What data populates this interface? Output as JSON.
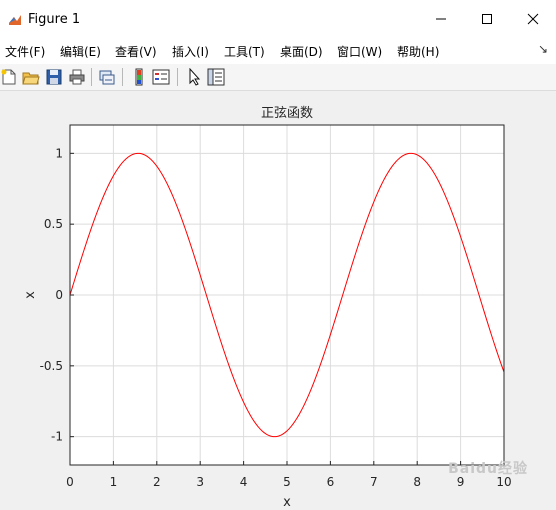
{
  "window": {
    "title": "Figure 1",
    "controls": [
      "minimize",
      "maximize",
      "close"
    ]
  },
  "menu": {
    "items": [
      {
        "label": "文件(F)"
      },
      {
        "label": "编辑(E)"
      },
      {
        "label": "查看(V)"
      },
      {
        "label": "插入(I)"
      },
      {
        "label": "工具(T)"
      },
      {
        "label": "桌面(D)"
      },
      {
        "label": "窗口(W)"
      },
      {
        "label": "帮助(H)"
      }
    ],
    "overflow_icon": "arrow-icon"
  },
  "toolbar": {
    "icons": [
      "new-figure-icon",
      "open-file-icon",
      "save-icon",
      "print-icon",
      "link-plot-icon",
      "colorbar-icon",
      "legend-icon",
      "edit-plot-icon",
      "property-inspector-icon"
    ]
  },
  "watermark": "Baidu经验",
  "chart_data": {
    "type": "line",
    "title": "正弦函数",
    "xlabel": "x",
    "ylabel": "x",
    "xlim": [
      0,
      10
    ],
    "ylim": [
      -1.2,
      1.2
    ],
    "xticks": [
      "0",
      "1",
      "2",
      "3",
      "4",
      "5",
      "6",
      "7",
      "8",
      "9",
      "10"
    ],
    "yticks": [
      "-1",
      "-0.5",
      "0",
      "0.5",
      "1"
    ],
    "grid": true,
    "series": [
      {
        "function": "sin(x)",
        "color": "#ff0000",
        "x": [
          0,
          0.5,
          1,
          1.5,
          1.5708,
          2,
          2.5,
          3,
          3.5,
          4,
          4.5,
          4.7124,
          5,
          5.5,
          6,
          6.5,
          7,
          7.5,
          7.854,
          8,
          8.5,
          9,
          9.5,
          10
        ],
        "y": [
          0,
          0.479,
          0.841,
          0.997,
          1,
          0.909,
          0.598,
          0.141,
          -0.351,
          -0.757,
          -0.978,
          -1,
          -0.959,
          -0.706,
          -0.279,
          0.215,
          0.657,
          0.938,
          1,
          0.989,
          0.798,
          0.412,
          -0.075,
          -0.544
        ]
      }
    ]
  }
}
